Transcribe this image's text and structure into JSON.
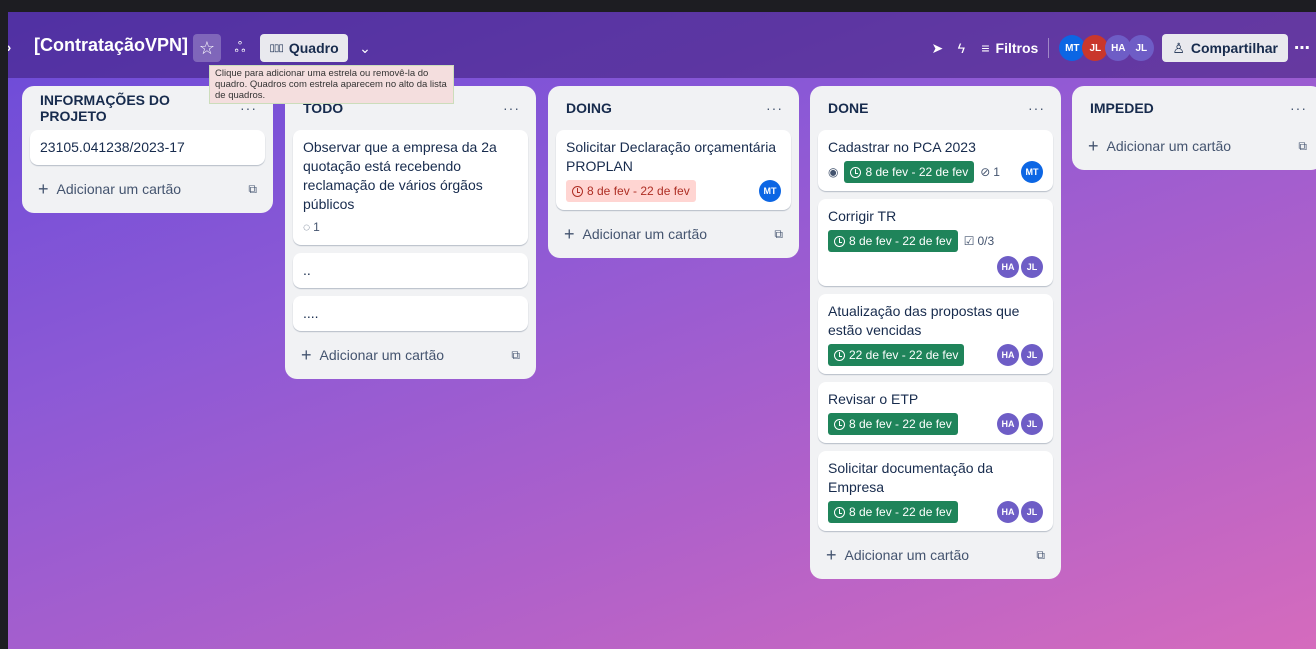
{
  "board": {
    "title": "[ContrataçãoVPN]",
    "view_label": "Quadro",
    "tooltip": "Clique para adicionar uma estrela ou removê-la do quadro. Quadros com estrela aparecem no alto da lista de quadros.",
    "filters_label": "Filtros",
    "share_label": "Compartilhar",
    "members": [
      {
        "initials": "MT",
        "color": "#0c66e4"
      },
      {
        "initials": "JL",
        "color": "#c9372c"
      },
      {
        "initials": "HA",
        "color": "#6e5dc6"
      },
      {
        "initials": "JL",
        "color": "#6e5dc6"
      }
    ]
  },
  "lists": [
    {
      "title": "INFORMAÇÕES DO PROJETO",
      "cards": [
        {
          "title": "23105.041238/2023-17"
        }
      ],
      "add_label": "Adicionar um cartão"
    },
    {
      "title": "TODO",
      "cards": [
        {
          "title": "Observar que a empresa da 2a quotação está recebendo reclamação de vários órgãos públicos",
          "comments": "1"
        },
        {
          "title": ".."
        },
        {
          "title": "...."
        }
      ],
      "add_label": "Adicionar um cartão"
    },
    {
      "title": "DOING",
      "cards": [
        {
          "title": "Solicitar Declaração orçamentária PROPLAN",
          "date": "8 de fev - 22 de fev",
          "member": "MT"
        }
      ],
      "add_label": "Adicionar um cartão"
    },
    {
      "title": "DONE",
      "cards": [
        {
          "title": "Cadastrar no PCA 2023",
          "date": "8 de fev - 22 de fev",
          "attachments": "1",
          "member": "MT"
        },
        {
          "title": "Corrigir TR",
          "date": "8 de fev - 22 de fev",
          "checklist": "0/3",
          "members": [
            "HA",
            "JL"
          ]
        },
        {
          "title": "Atualização das propostas que estão vencidas",
          "date": "22 de fev - 22 de fev",
          "members": [
            "HA",
            "JL"
          ]
        },
        {
          "title": "Revisar o ETP",
          "date": "8 de fev - 22 de fev",
          "members": [
            "HA",
            "JL"
          ]
        },
        {
          "title": "Solicitar documentação da Empresa",
          "date": "8 de fev - 22 de fev",
          "members": [
            "HA",
            "JL"
          ]
        }
      ],
      "add_label": "Adicionar um cartão"
    },
    {
      "title": "IMPEDED",
      "cards": [],
      "add_label": "Adicionar um cartão"
    }
  ],
  "colors": {
    "accent_green": "#1f845a",
    "overdue_red": "#ffd5d2",
    "avatar_blue": "#0c66e4",
    "avatar_purple": "#6e5dc6"
  }
}
